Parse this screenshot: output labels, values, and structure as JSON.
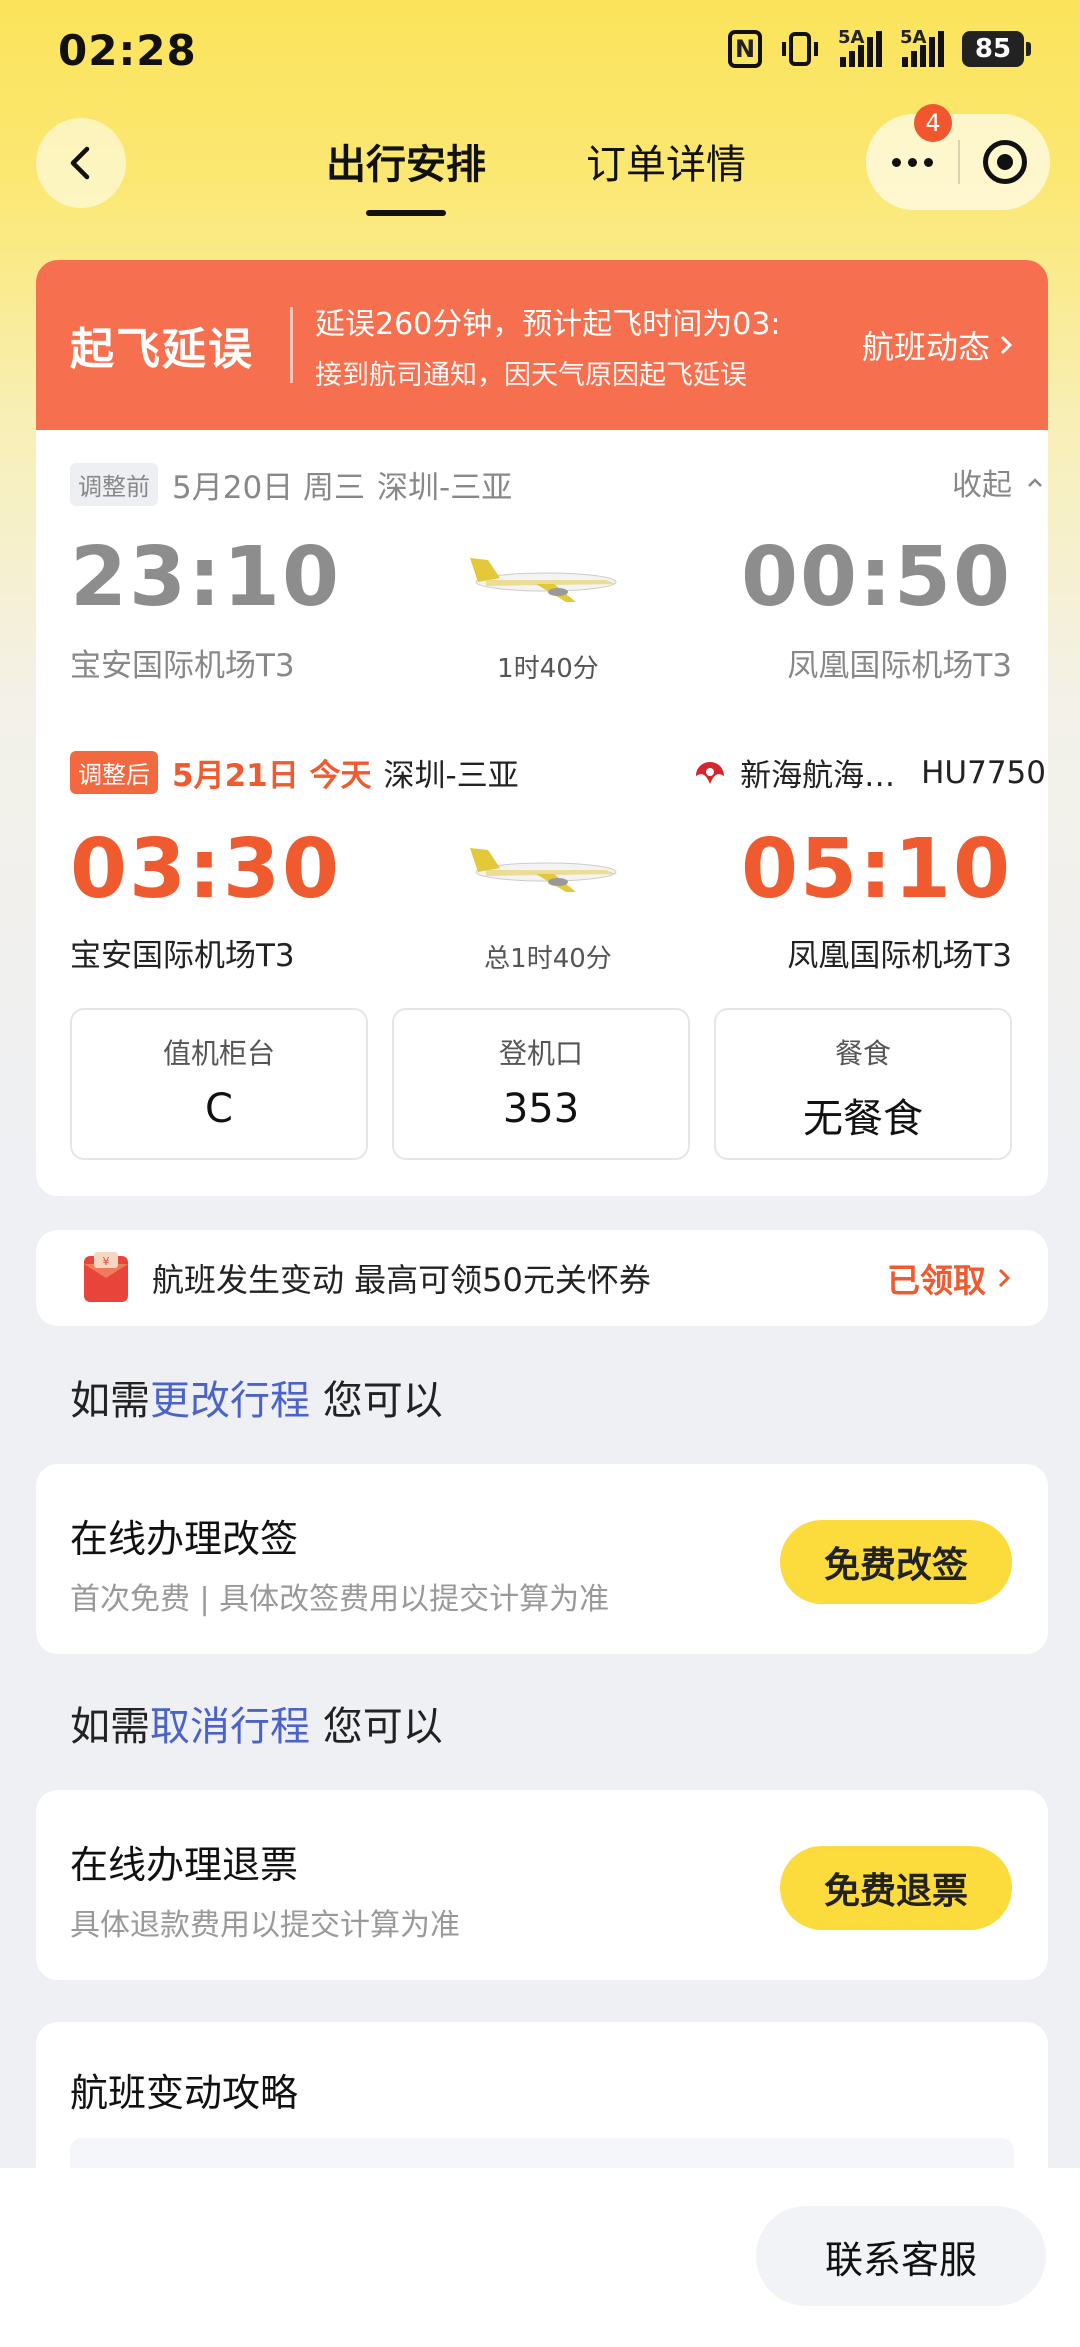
{
  "status_bar": {
    "time": "02:28",
    "nfc": "N",
    "signal1": "5A",
    "signal2": "5A",
    "battery": "85"
  },
  "nav": {
    "tab_trip": "出行安排",
    "tab_order": "订单详情",
    "badge_count": "4"
  },
  "delay": {
    "title": "起飞延误",
    "message": "延误260分钟，预计起飞时间为03:",
    "sub": "接到航司通知，因天气原因起飞延误",
    "link": "航班动态"
  },
  "before": {
    "tag": "调整前",
    "date": "5月20日 周三",
    "route": "深圳-三亚",
    "collapse": "收起",
    "dep_time": "23:10",
    "arr_time": "00:50",
    "dep_airport": "宝安国际机场T3",
    "arr_airport": "凤凰国际机场T3",
    "duration": "1时40分"
  },
  "after": {
    "tag": "调整后",
    "date": "5月21日 今天",
    "route": "深圳-三亚",
    "airline": "新海航海…",
    "flight_no": "HU7750",
    "dep_time": "03:30",
    "arr_time": "05:10",
    "dep_airport": "宝安国际机场T3",
    "arr_airport": "凤凰国际机场T3",
    "duration": "总1时40分"
  },
  "info": [
    {
      "label": "值机柜台",
      "value": "C"
    },
    {
      "label": "登机口",
      "value": "353"
    },
    {
      "label": "餐食",
      "value": "无餐食"
    }
  ],
  "coupon": {
    "text": "航班发生变动 最高可领50元关怀券",
    "action": "已领取"
  },
  "change": {
    "q_prefix": "如需",
    "q_highlight": "更改行程",
    "q_suffix": " 您可以",
    "title": "在线办理改签",
    "sub": "首次免费 | 具体改签费用以提交计算为准",
    "button": "免费改签"
  },
  "cancel": {
    "q_prefix": "如需",
    "q_highlight": "取消行程",
    "q_suffix": " 您可以",
    "title": "在线办理退票",
    "sub": "具体退款费用以提交计算为准",
    "button": "免费退票"
  },
  "guide": {
    "title": "航班变动攻略"
  },
  "bottom": {
    "contact": "联系客服"
  },
  "colors": {
    "brand_yellow": "#fbdc3c",
    "delay_red": "#f6704f",
    "accent_red": "#ef5a2f",
    "link_blue": "#4b63c8"
  },
  "icons": [
    "back-arrow-icon",
    "more-dots-icon",
    "record-icon",
    "chevron-right-icon",
    "chevron-up-icon",
    "plane-icon",
    "airline-logo-icon",
    "red-envelope-icon"
  ]
}
